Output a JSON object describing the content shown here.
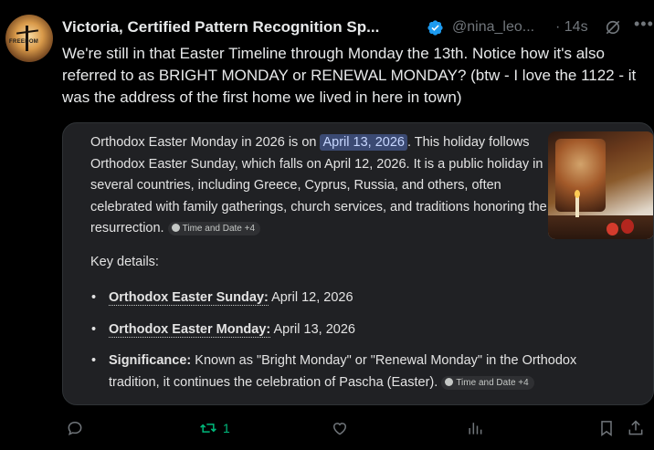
{
  "post": {
    "author_name": "Victoria, Certified Pattern Recognition Sp...",
    "handle": "@nina_leo...",
    "separator": "·",
    "time": "14s",
    "avatar_text": "FREEDOM",
    "text": "We're still in that Easter Timeline through Monday the 13th.  Notice how it's also referred to as BRIGHT MONDAY or RENEWAL MONDAY?  (btw - I love the 1122 - it was the address of the first home we lived in here in town)"
  },
  "card": {
    "intro_before": "Orthodox Easter Monday in 2026 is on ",
    "intro_highlight": "April 13, 2026",
    "intro_after": ". This holiday follows Orthodox Easter Sunday, which falls on April 12, 2026. It is a public holiday in several countries, including Greece, Cyprus, Russia, and others, often celebrated with family gatherings, church services, and traditions honoring the resurrection. ",
    "source_chip": "Time and Date +4",
    "key_details": "Key details:",
    "details": [
      {
        "label": "Orthodox Easter Sunday:",
        "value": " April 12, 2026"
      },
      {
        "label": "Orthodox Easter Monday:",
        "value": " April 13, 2026"
      },
      {
        "label": "Significance:",
        "value": " Known as \"Bright Monday\" or \"Renewal Monday\" in the Orthodox tradition, it continues the celebration of Pascha (Easter). "
      }
    ],
    "source_chip_2": "Time and Date +4"
  },
  "actions": {
    "reply_count": "",
    "repost_count": "1",
    "like_count": "",
    "views_count": ""
  },
  "colors": {
    "background": "#000000",
    "text": "#e7e9ea",
    "muted": "#71767b",
    "verified": "#1d9bf0",
    "repost": "#00ba7c",
    "card_bg": "#202124",
    "highlight": "#3b4a73"
  }
}
